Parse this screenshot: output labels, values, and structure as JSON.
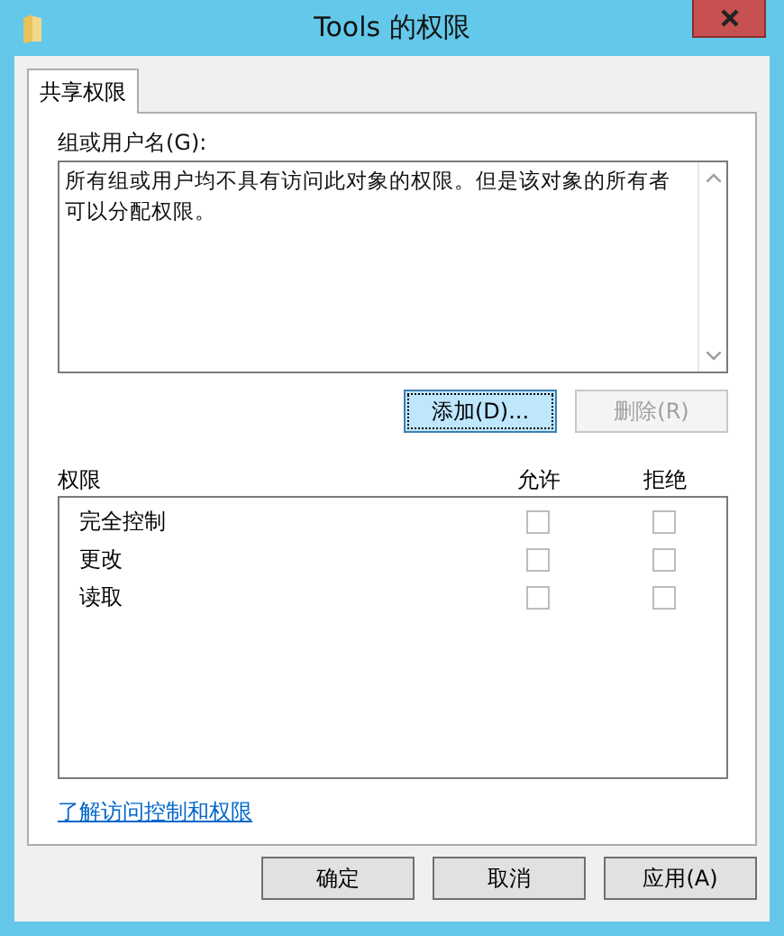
{
  "window": {
    "title": "Tools 的权限"
  },
  "tabs": [
    {
      "label": "共享权限",
      "selected": true
    }
  ],
  "group_label": "组或用户名(G):",
  "group_message": "所有组或用户均不具有访问此对象的权限。但是该对象的所有者可以分配权限。",
  "group_buttons": [
    {
      "label": "添加(D)...",
      "disabled": false,
      "focused": true
    },
    {
      "label": "删除(R)",
      "disabled": true,
      "focused": false
    }
  ],
  "permissions_label": "权限",
  "columns": [
    "允许",
    "拒绝"
  ],
  "permissions": [
    {
      "name": "完全控制",
      "allow": false,
      "deny": false,
      "disabled": true
    },
    {
      "name": "更改",
      "allow": false,
      "deny": false,
      "disabled": true
    },
    {
      "name": "读取",
      "allow": false,
      "deny": false,
      "disabled": true
    }
  ],
  "link": "了解访问控制和权限",
  "buttons": [
    "确定",
    "取消",
    "应用(A)"
  ]
}
